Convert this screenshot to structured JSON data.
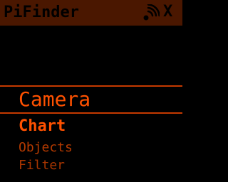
{
  "header": {
    "title": "PiFinder",
    "close_label": "X",
    "status_icon": "wifi-signal-icon"
  },
  "menu": {
    "selected_label": "Camera",
    "items": [
      {
        "label": "Chart"
      },
      {
        "label": "Objects"
      },
      {
        "label": "Filter"
      }
    ]
  },
  "colors": {
    "background": "#000000",
    "titlebar": "#4a1700",
    "accent": "#ff5100",
    "dim_text": "#b53a00",
    "divider": "#c63a00"
  }
}
